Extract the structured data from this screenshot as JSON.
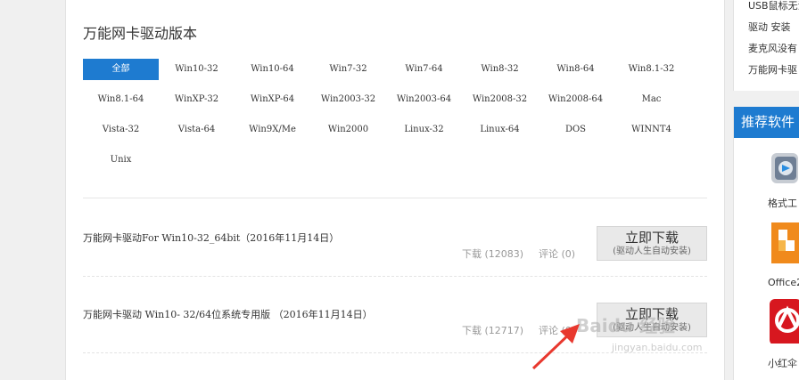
{
  "section": {
    "title": "万能网卡驱动版本"
  },
  "filters": [
    "全部",
    "Win10-32",
    "Win10-64",
    "Win7-32",
    "Win7-64",
    "Win8-32",
    "Win8-64",
    "Win8.1-32",
    "Win8.1-64",
    "WinXP-32",
    "WinXP-64",
    "Win2003-32",
    "Win2003-64",
    "Win2008-32",
    "Win2008-64",
    "Mac",
    "Vista-32",
    "Vista-64",
    "Win9X/Me",
    "Win2000",
    "Linux-32",
    "Linux-64",
    "DOS",
    "WINNT4",
    "Unix"
  ],
  "active_filter": "全部",
  "items": [
    {
      "title": "万能网卡驱动For Win10-32_64bit（2016年11月14日）",
      "downloads": "下载 (12083)",
      "comments": "评论 (0)",
      "btn_main": "立即下载",
      "btn_sub": "(驱动人生自动安装)"
    },
    {
      "title": "万能网卡驱动 Win10- 32/64位系统专用版 （2016年11月14日）",
      "downloads": "下载 (12717)",
      "comments": "评论 (0)",
      "btn_main": "立即下载",
      "btn_sub": "(驱动人生自动安装)"
    }
  ],
  "sidebar_links": [
    "USB鼠标无法",
    "驱动 安装",
    "麦克风没有",
    "万能网卡驱"
  ],
  "recommend": {
    "title": "推荐软件",
    "apps": [
      {
        "label": "格式工",
        "icon": "format-factory-icon"
      },
      {
        "label": "Office2",
        "icon": "office-icon"
      },
      {
        "label": "小红伞",
        "icon": "avira-icon"
      }
    ]
  },
  "watermark": {
    "text": "Baidu 经验",
    "sub": "jingyan.baidu.com"
  },
  "colors": {
    "accent": "#1e7bd0",
    "arrow": "#e8382e"
  }
}
